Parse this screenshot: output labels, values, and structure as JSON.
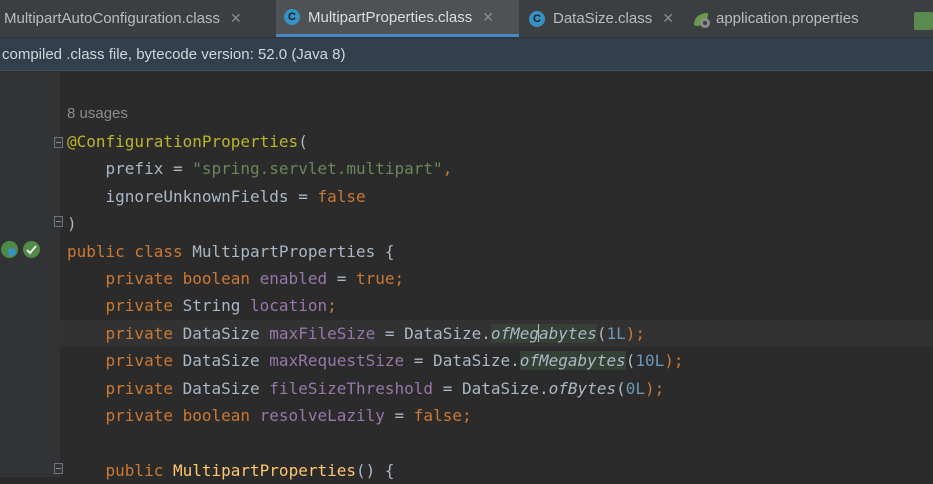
{
  "tabs": [
    {
      "label": "MultipartAutoConfiguration.class",
      "icon": "none",
      "close": "✕"
    },
    {
      "label": "MultipartProperties.class",
      "icon": "class-icon",
      "icon_glyph": "C",
      "close": "✕",
      "active": true
    },
    {
      "label": "DataSize.class",
      "icon": "class-icon",
      "icon_glyph": "C",
      "close": "✕"
    },
    {
      "label": "application.properties",
      "icon": "spring-properties-icon",
      "close": ""
    }
  ],
  "info_bar": {
    "text": "compiled .class file, bytecode version: 52.0 (Java 8)"
  },
  "code": {
    "usages": "8 usages",
    "lines": [
      {
        "tokens": [
          {
            "t": "@ConfigurationProperties",
            "c": "ann"
          },
          {
            "t": "(",
            "c": ""
          }
        ]
      },
      {
        "tokens": [
          {
            "t": "    prefix = ",
            "c": ""
          },
          {
            "t": "\"spring.servlet.multipart\"",
            "c": "str"
          },
          {
            "t": ",",
            "c": "kw"
          }
        ]
      },
      {
        "tokens": [
          {
            "t": "    ignoreUnknownFields = ",
            "c": ""
          },
          {
            "t": "false",
            "c": "kw"
          }
        ]
      },
      {
        "tokens": [
          {
            "t": ")",
            "c": ""
          }
        ]
      },
      {
        "tokens": [
          {
            "t": "public class ",
            "c": "kw"
          },
          {
            "t": "MultipartProperties {",
            "c": ""
          }
        ]
      },
      {
        "tokens": [
          {
            "t": "    private boolean ",
            "c": "kw"
          },
          {
            "t": "enabled",
            "c": "fld"
          },
          {
            "t": " = ",
            "c": ""
          },
          {
            "t": "true;",
            "c": "kw"
          }
        ]
      },
      {
        "tokens": [
          {
            "t": "    private ",
            "c": "kw"
          },
          {
            "t": "String ",
            "c": ""
          },
          {
            "t": "location",
            "c": "fld"
          },
          {
            "t": ";",
            "c": "kw"
          }
        ]
      },
      {
        "tokens": [
          {
            "t": "    private ",
            "c": "kw"
          },
          {
            "t": "DataSize ",
            "c": ""
          },
          {
            "t": "maxFileSize",
            "c": "fld"
          },
          {
            "t": " = DataSize.",
            "c": ""
          },
          {
            "t": "ofMeg",
            "c": "mth hl"
          },
          {
            "t": "|",
            "c": "caret"
          },
          {
            "t": "abytes",
            "c": "mth hl"
          },
          {
            "t": "(",
            "c": ""
          },
          {
            "t": "1L",
            "c": "num"
          },
          {
            "t": ");",
            "c": "kw"
          }
        ]
      },
      {
        "tokens": [
          {
            "t": "    private ",
            "c": "kw"
          },
          {
            "t": "DataSize ",
            "c": ""
          },
          {
            "t": "maxRequestSize",
            "c": "fld"
          },
          {
            "t": " = DataSize.",
            "c": ""
          },
          {
            "t": "ofMegabytes",
            "c": "mth hl"
          },
          {
            "t": "(",
            "c": ""
          },
          {
            "t": "10L",
            "c": "num"
          },
          {
            "t": ");",
            "c": "kw"
          }
        ]
      },
      {
        "tokens": [
          {
            "t": "    private ",
            "c": "kw"
          },
          {
            "t": "DataSize ",
            "c": ""
          },
          {
            "t": "fileSizeThreshold",
            "c": "fld"
          },
          {
            "t": " = DataSize.",
            "c": ""
          },
          {
            "t": "ofBytes",
            "c": "mth"
          },
          {
            "t": "(",
            "c": ""
          },
          {
            "t": "0L",
            "c": "num"
          },
          {
            "t": ");",
            "c": "kw"
          }
        ]
      },
      {
        "tokens": [
          {
            "t": "    private boolean ",
            "c": "kw"
          },
          {
            "t": "resolveLazily",
            "c": "fld"
          },
          {
            "t": " = ",
            "c": ""
          },
          {
            "t": "false;",
            "c": "kw"
          }
        ]
      },
      {
        "tokens": []
      },
      {
        "tokens": [
          {
            "t": "    public ",
            "c": "kw"
          },
          {
            "t": "MultipartProperties",
            "c": "fnname"
          },
          {
            "t": "() {",
            "c": ""
          }
        ]
      }
    ]
  },
  "colors": {
    "editor_bg": "#2b2b2b",
    "keyword": "#cc7832",
    "annotation": "#bbb529",
    "string": "#6a8759",
    "field": "#9876aa",
    "number": "#6897bb",
    "accent": "#4a88c7"
  }
}
